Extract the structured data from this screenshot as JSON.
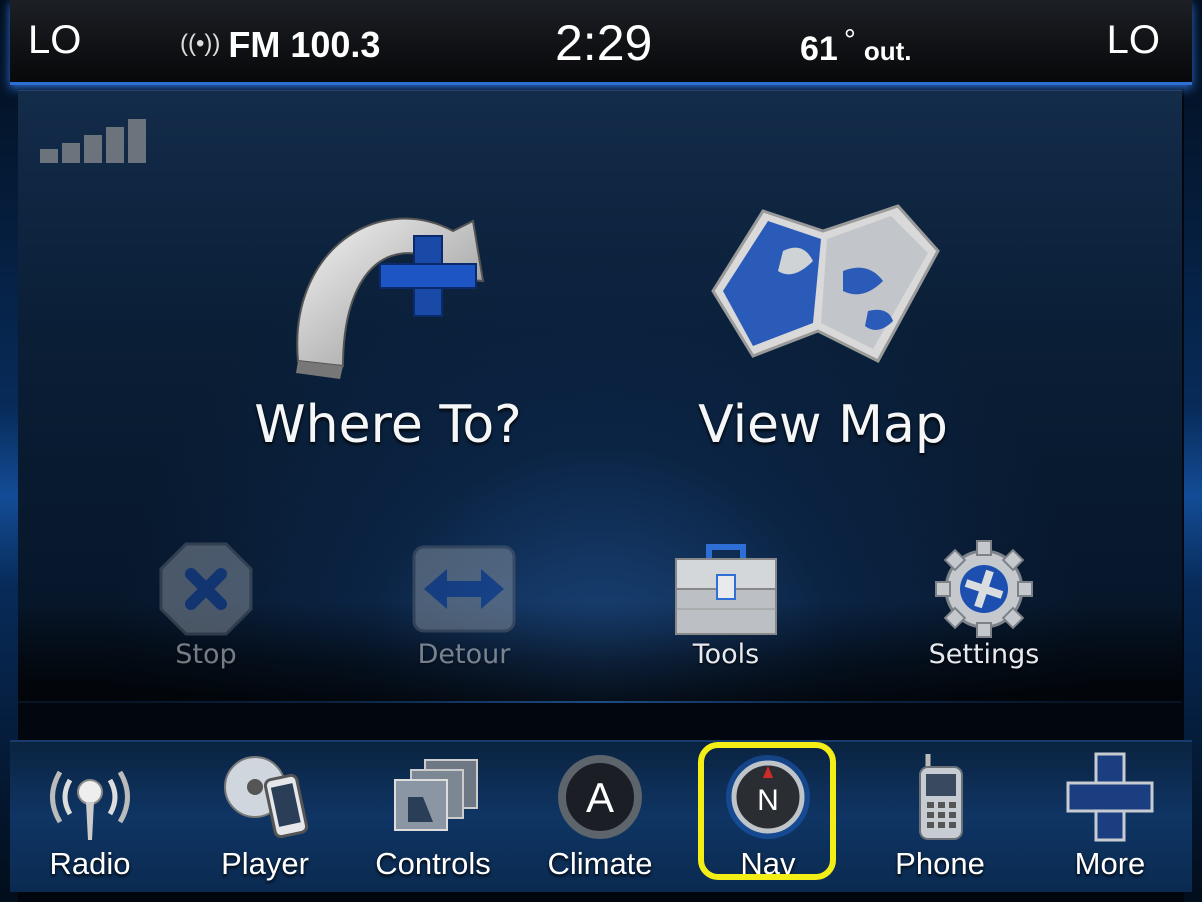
{
  "status_bar": {
    "left_temp": "LO",
    "radio_icon": "antenna-icon",
    "radio_station": "FM 100.3",
    "time": "2:29",
    "outside_temp": "61",
    "degree_symbol": "°",
    "outside_label": "out.",
    "right_temp": "LO"
  },
  "signal": {
    "icon": "signal-strength-icon",
    "bars_filled": 5,
    "bars_total": 5
  },
  "main": {
    "where_to": {
      "label": "Where To?",
      "icon": "where-to-arrow-icon"
    },
    "view_map": {
      "label": "View Map",
      "icon": "map-icon"
    },
    "stop": {
      "label": "Stop",
      "icon": "stop-icon",
      "enabled": false
    },
    "detour": {
      "label": "Detour",
      "icon": "detour-icon",
      "enabled": false
    },
    "tools": {
      "label": "Tools",
      "icon": "toolbox-icon",
      "enabled": true
    },
    "settings": {
      "label": "Settings",
      "icon": "gear-icon",
      "enabled": true
    }
  },
  "nav_bar": {
    "items": [
      {
        "label": "Radio",
        "icon": "radio-icon"
      },
      {
        "label": "Player",
        "icon": "player-icon"
      },
      {
        "label": "Controls",
        "icon": "controls-icon"
      },
      {
        "label": "Climate",
        "icon": "climate-icon"
      },
      {
        "label": "Nav",
        "icon": "compass-icon"
      },
      {
        "label": "Phone",
        "icon": "phone-icon"
      },
      {
        "label": "More",
        "icon": "plus-icon"
      }
    ],
    "selected": "Nav"
  },
  "colors": {
    "accent_blue": "#2e6fd6",
    "highlight_yellow": "#f2ee16",
    "background": "#02070f"
  }
}
